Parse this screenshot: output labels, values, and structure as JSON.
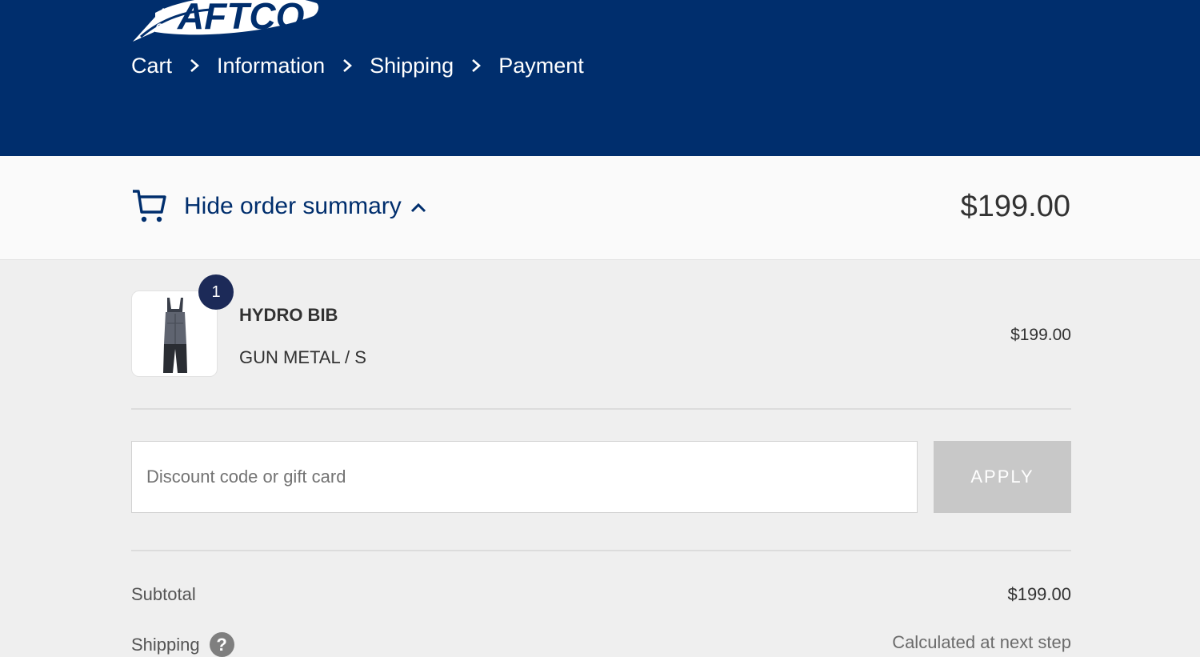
{
  "brand": {
    "logo_text": "AFTCO",
    "header_color": "#002e6d"
  },
  "breadcrumb": [
    {
      "label": "Cart"
    },
    {
      "label": "Information"
    },
    {
      "label": "Shipping"
    },
    {
      "label": "Payment"
    }
  ],
  "summary_toggle": {
    "icon": "cart-icon",
    "label": "Hide order summary",
    "chevron": "chevron-up-icon",
    "total": "$199.00"
  },
  "line_items": [
    {
      "quantity": "1",
      "name": "HYDRO BIB",
      "variant": "GUN METAL / S",
      "price": "$199.00"
    }
  ],
  "discount": {
    "placeholder": "Discount code or gift card",
    "value": "",
    "apply_label": "APPLY"
  },
  "totals": {
    "subtotal_label": "Subtotal",
    "subtotal_value": "$199.00",
    "shipping_label": "Shipping",
    "shipping_help_icon": "question-icon",
    "shipping_value": "Calculated at next step"
  }
}
